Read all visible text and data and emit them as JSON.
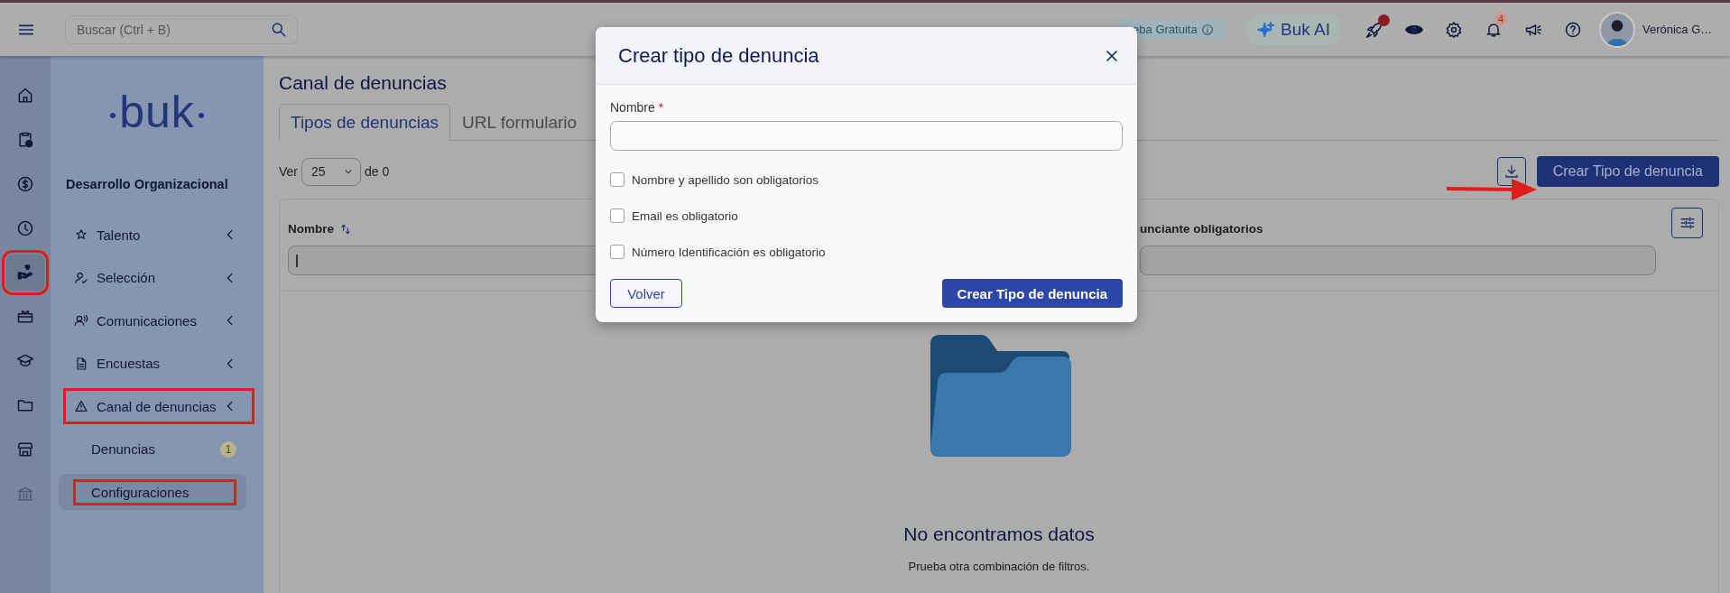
{
  "topbar": {
    "search": {
      "placeholder": "Buscar (Ctrl + B)"
    },
    "trial_badge": "eba Gratuita",
    "ai_button": "Buk AI",
    "rocket_alert": true,
    "notification_count": "4",
    "user_name": "Verónica G…"
  },
  "rail": [
    {
      "kind": "home",
      "selected": false,
      "highlighted": false
    },
    {
      "kind": "clipboard",
      "selected": false,
      "highlighted": false
    },
    {
      "kind": "dollar",
      "selected": false,
      "highlighted": false
    },
    {
      "kind": "clock",
      "selected": false,
      "highlighted": false
    },
    {
      "kind": "heart-hand",
      "selected": true,
      "highlighted": true
    },
    {
      "kind": "gift",
      "selected": false,
      "highlighted": false
    },
    {
      "kind": "graduation",
      "selected": false,
      "highlighted": false
    },
    {
      "kind": "folder",
      "selected": false,
      "highlighted": false
    },
    {
      "kind": "store",
      "selected": false,
      "highlighted": false
    },
    {
      "kind": "bank",
      "selected": false,
      "highlighted": false
    }
  ],
  "sidebar": {
    "logo": "buk",
    "section": "Desarrollo Organizacional",
    "items": [
      {
        "label": "Talento",
        "kind": "star",
        "highlighted": false
      },
      {
        "label": "Selección",
        "kind": "user-check",
        "highlighted": false
      },
      {
        "label": "Comunicaciones",
        "kind": "user-voice",
        "highlighted": false
      },
      {
        "label": "Encuestas",
        "kind": "document",
        "highlighted": false
      },
      {
        "label": "Canal de denuncias",
        "kind": "warning",
        "highlighted": true,
        "children": [
          {
            "label": "Denuncias",
            "badge": "1",
            "selected": false,
            "highlighted": false
          },
          {
            "label": "Configuraciones",
            "selected": true,
            "highlighted": true
          }
        ]
      }
    ]
  },
  "page": {
    "title": "Canal de denuncias",
    "tabs": [
      {
        "label": "Tipos de denuncias",
        "selected": true
      },
      {
        "label": "URL formulario",
        "selected": false
      }
    ],
    "page_size": {
      "prefix": "Ver",
      "value": "25",
      "suffix": "de 0"
    },
    "create_button": "Crear Tipo de denuncia",
    "table": {
      "columns": [
        {
          "label": "Nombre",
          "sortable": true
        },
        {
          "label": "unciante obligatorios"
        }
      ]
    },
    "empty_state": {
      "title": "No encontramos datos",
      "message": "Prueba otra combinación de filtros."
    }
  },
  "modal": {
    "title": "Crear tipo de denuncia",
    "field": {
      "label": "Nombre",
      "required_mark": "*"
    },
    "options": [
      {
        "label": "Nombre y apellido son obligatorios",
        "checked": false
      },
      {
        "label": "Email es obligatorio",
        "checked": false
      },
      {
        "label": "Número Identificación es obligatorio",
        "checked": false
      }
    ],
    "buttons": [
      {
        "label": "Volver",
        "kind": "secondary"
      },
      {
        "label": "Crear Tipo de denuncia",
        "kind": "primary"
      }
    ]
  }
}
